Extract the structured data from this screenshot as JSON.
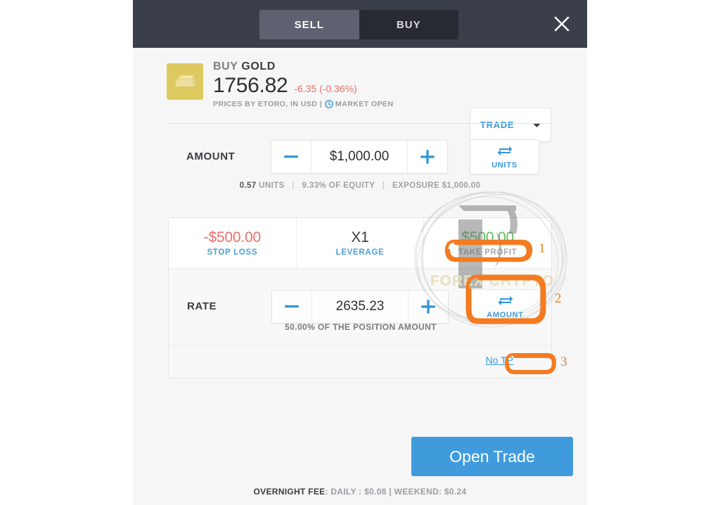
{
  "header": {
    "tab_sell": "SELL",
    "tab_buy": "BUY",
    "close_icon": "close-icon"
  },
  "instrument": {
    "action": "BUY",
    "name": "GOLD",
    "price": "1756.82",
    "change": "-6.35 (-0.36%)",
    "meta_prefix": "PRICES BY ETORO, IN USD  |",
    "market_status": "MARKET OPEN",
    "clock_icon": "clock-icon",
    "asset_icon": "gold-bar-icon",
    "trade_select_label": "TRADE",
    "chevron_icon": "chevron-down-icon"
  },
  "amount": {
    "label": "AMOUNT",
    "value": "$1,000.00",
    "minus": "−",
    "plus": "+",
    "toggle_label": "UNITS",
    "toggle_icon": "swap-arrows-icon",
    "meta_units_value": "0.57",
    "meta_units_label": "UNITS",
    "meta_equity": "9.33% OF EQUITY",
    "meta_exposure": "EXPOSURE $1,000.00"
  },
  "position": {
    "stop_loss_value": "-$500.00",
    "stop_loss_label": "STOP LOSS",
    "leverage_value": "X1",
    "leverage_label": "LEVERAGE",
    "take_profit_value": "$500.00",
    "take_profit_label": "TAKE PROFIT",
    "rate_label": "RATE",
    "rate_value": "2635.23",
    "minus": "−",
    "plus": "+",
    "rate_toggle_label": "AMOUNT",
    "rate_toggle_icon": "swap-arrows-icon",
    "rate_meta": "50.00% OF THE POSITION AMOUNT",
    "no_tp_link": "No TP"
  },
  "submit": {
    "open_trade_label": "Open Trade",
    "overnight_fee_label": "OVERNIGHT FEE",
    "overnight_fee_detail": ": DAILY : $0.08  |  WEEKEND: $0.24"
  },
  "watermark": {
    "text": "FOREX CRYPTO"
  },
  "annotations": {
    "marker_1": "1",
    "marker_2": "2",
    "marker_3": "3",
    "color": "#f47b20"
  },
  "colors": {
    "accent_blue": "#3498db",
    "header_bg": "#3b3f4a",
    "negative_red": "#e8706c",
    "positive_green": "#5fbd63",
    "gold": "#dec961"
  }
}
